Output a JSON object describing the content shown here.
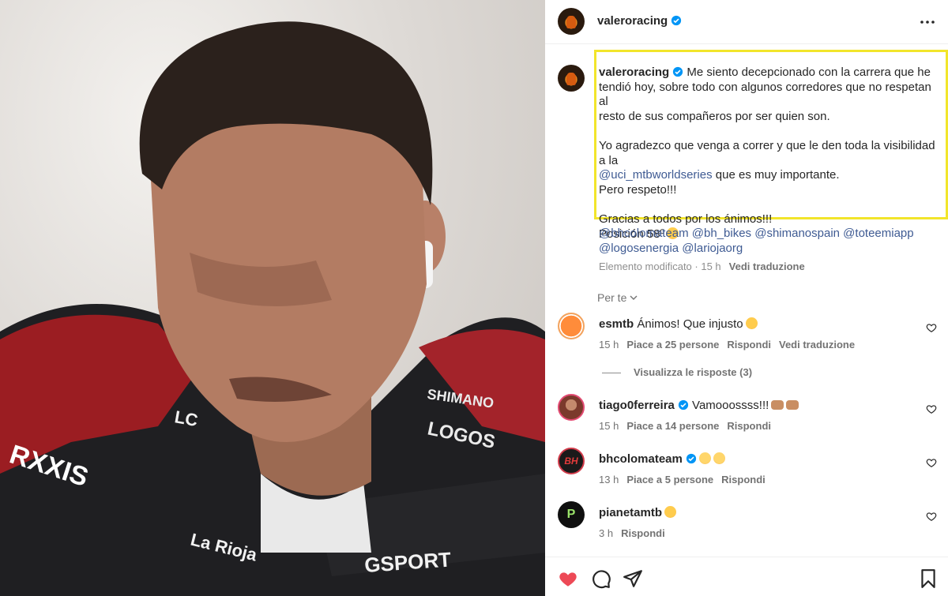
{
  "post": {
    "author": "valeroracing",
    "caption_lines": [
      "Me siento decepcionado con la carrera que he",
      "tendió hoy, sobre todo con algunos corredores que no respetan al",
      "resto de sus compañeros por ser quien son."
    ],
    "caption_p2_line1": "Yo agradezco que venga a correr y que le den toda la visibilidad a la",
    "caption_p2_mention": "@uci_mtbworldseries",
    "caption_p2_rest": " que es muy importante.",
    "caption_p2_line3": "Pero respeto!!!",
    "caption_p3_line1": "Gracias a todos por los ánimos!!!",
    "caption_p3_line2": "Posición 58º",
    "tags_line1": "@bhcolomateam @bh_bikes @shimanospain @toteemiapp",
    "tags_line2": "@logosenergia @lariojaorg",
    "edited_label": "Elemento modificato · 15 h",
    "see_translation": "Vedi traduzione"
  },
  "filter": {
    "label": "Per te"
  },
  "comments": [
    {
      "user": "esmtb",
      "text": "Ánimos! Que injusto",
      "time": "15 h",
      "likes": "Piace a 25 persone",
      "reply": "Rispondi",
      "translate": "Vedi traduzione",
      "view_replies": "Visualizza le risposte (3)"
    },
    {
      "user": "tiago0ferreira",
      "text": "Vamooossss!!!",
      "time": "15 h",
      "likes": "Piace a 14 persone",
      "reply": "Rispondi"
    },
    {
      "user": "bhcolomateam",
      "text": "",
      "time": "13 h",
      "likes": "Piace a 5 persone",
      "reply": "Rispondi",
      "avatar_text": "BH"
    },
    {
      "user": "pianetamtb",
      "text": "",
      "time": "3 h",
      "reply": "Rispondi",
      "avatar_text": "P"
    }
  ],
  "photo": {
    "jersey_texts": [
      "RXXIS",
      "SHIMANO",
      "LOGOS",
      "GSPORT",
      "La Rioja",
      "LC"
    ]
  },
  "colors": {
    "accent_link": "#3f5b93",
    "highlight": "#f2e52b",
    "like_red": "#ed4956",
    "verified": "#0095f6"
  },
  "icons": [
    "more-icon",
    "verified-icon",
    "heart-icon",
    "comment-icon",
    "share-icon",
    "bookmark-icon",
    "chevron-down-icon"
  ]
}
